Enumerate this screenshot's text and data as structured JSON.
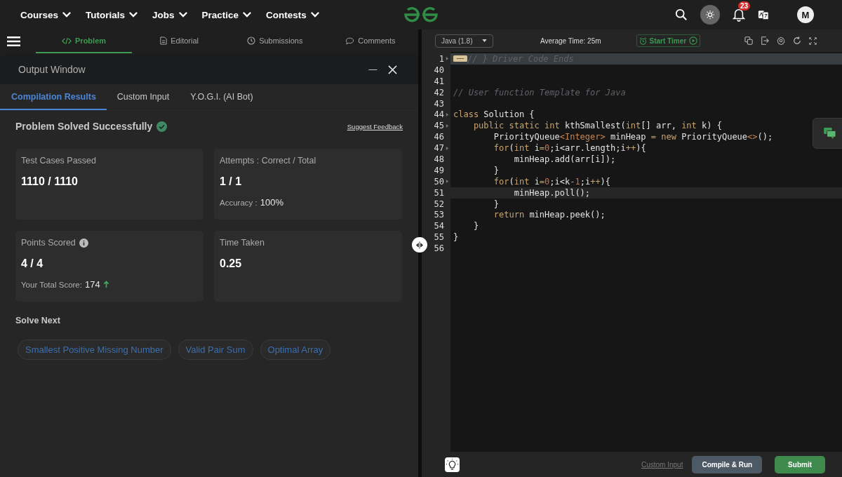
{
  "nav": {
    "items": [
      {
        "label": "Courses"
      },
      {
        "label": "Tutorials"
      },
      {
        "label": "Jobs"
      },
      {
        "label": "Practice"
      },
      {
        "label": "Contests"
      }
    ],
    "notification_count": "23",
    "avatar": "M"
  },
  "problem_tabs": [
    {
      "label": "Problem",
      "selected": true
    },
    {
      "label": "Editorial",
      "selected": false
    },
    {
      "label": "Submissions",
      "selected": false
    },
    {
      "label": "Comments",
      "selected": false
    }
  ],
  "output_window": {
    "title": "Output Window",
    "tabs": [
      {
        "label": "Compilation Results",
        "selected": true
      },
      {
        "label": "Custom Input",
        "selected": false
      },
      {
        "label": "Y.O.G.I. (AI Bot)",
        "selected": false
      }
    ],
    "status": "Problem Solved Successfully",
    "feedback_link": "Suggest Feedback",
    "cards": [
      {
        "label": "Test Cases Passed",
        "value": "1110 / 1110"
      },
      {
        "label": "Attempts : Correct / Total",
        "value": "1 / 1",
        "note": {
          "label": "Accuracy :",
          "value": "100%"
        }
      },
      {
        "label": "Points Scored",
        "info": true,
        "value": "4 / 4",
        "note": {
          "label": "Your Total Score:",
          "value": "174",
          "rising": true
        }
      },
      {
        "label": "Time Taken",
        "value": "0.25"
      }
    ],
    "solve_next": {
      "title": "Solve Next",
      "items": [
        "Smallest Positive Missing Number",
        "Valid Pair Sum",
        "Optimal Array"
      ]
    }
  },
  "editor": {
    "language": "Java (1.8)",
    "average_time": "Average Time: 25m",
    "timer_button": "Start Timer",
    "lines": [
      {
        "number": "1",
        "fold": true,
        "highlighted": true,
        "folded": true,
        "tokens": [
          {
            "kind": "comment",
            "text": "// } Driver Code Ends"
          }
        ]
      },
      {
        "number": "40",
        "fold": false,
        "highlighted": false
      },
      {
        "number": "41",
        "fold": false,
        "highlighted": false
      },
      {
        "number": "42",
        "fold": false,
        "highlighted": false,
        "tokens": [
          {
            "kind": "comment",
            "text": "// User function Template for Java"
          }
        ]
      },
      {
        "number": "43",
        "fold": false,
        "highlighted": false
      },
      {
        "number": "44",
        "fold": true,
        "highlighted": false,
        "tokens": [
          {
            "kind": "keyword",
            "text": "class"
          },
          {
            "kind": "plain",
            "text": " Solution {"
          }
        ]
      },
      {
        "number": "45",
        "fold": true,
        "highlighted": false,
        "tokens": [
          {
            "kind": "keyword",
            "text": "    public static int"
          },
          {
            "kind": "plain",
            "text": " kthSmallest("
          },
          {
            "kind": "keyword",
            "text": "int"
          },
          {
            "kind": "plain",
            "text": "[] arr, "
          },
          {
            "kind": "keyword",
            "text": "int"
          },
          {
            "kind": "plain",
            "text": " k) {"
          }
        ]
      },
      {
        "number": "46",
        "fold": false,
        "highlighted": false,
        "tokens": [
          {
            "kind": "plain",
            "text": "        PriorityQueue"
          },
          {
            "kind": "type",
            "text": "<Integer>"
          },
          {
            "kind": "plain",
            "text": " minHeap "
          },
          {
            "kind": "operator",
            "text": "="
          },
          {
            "kind": "keyword",
            "text": " new"
          },
          {
            "kind": "plain",
            "text": " PriorityQueue"
          },
          {
            "kind": "type",
            "text": "<>"
          },
          {
            "kind": "plain",
            "text": "();"
          }
        ]
      },
      {
        "number": "47",
        "fold": true,
        "highlighted": false,
        "tokens": [
          {
            "kind": "keyword",
            "text": "        for"
          },
          {
            "kind": "plain",
            "text": "("
          },
          {
            "kind": "keyword",
            "text": "int"
          },
          {
            "kind": "plain",
            "text": " i"
          },
          {
            "kind": "operator",
            "text": "="
          },
          {
            "kind": "number",
            "text": "0"
          },
          {
            "kind": "plain",
            "text": ";i<arr.length;i"
          },
          {
            "kind": "operator",
            "text": "++"
          },
          {
            "kind": "plain",
            "text": "){"
          }
        ]
      },
      {
        "number": "48",
        "fold": false,
        "highlighted": false,
        "tokens": [
          {
            "kind": "plain",
            "text": "            minHeap.add(arr[i]);"
          }
        ]
      },
      {
        "number": "49",
        "fold": false,
        "highlighted": false,
        "tokens": [
          {
            "kind": "plain",
            "text": "        }"
          }
        ]
      },
      {
        "number": "50",
        "fold": true,
        "highlighted": false,
        "tokens": [
          {
            "kind": "keyword",
            "text": "        for"
          },
          {
            "kind": "plain",
            "text": "("
          },
          {
            "kind": "keyword",
            "text": "int"
          },
          {
            "kind": "plain",
            "text": " i"
          },
          {
            "kind": "operator",
            "text": "="
          },
          {
            "kind": "number",
            "text": "0"
          },
          {
            "kind": "plain",
            "text": ";i<k"
          },
          {
            "kind": "operator",
            "text": "-"
          },
          {
            "kind": "number",
            "text": "1"
          },
          {
            "kind": "plain",
            "text": ";i"
          },
          {
            "kind": "operator",
            "text": "++"
          },
          {
            "kind": "plain",
            "text": "){"
          }
        ]
      },
      {
        "number": "51",
        "fold": false,
        "highlighted": true,
        "tokens": [
          {
            "kind": "plain",
            "text": "            minHeap.poll();"
          }
        ]
      },
      {
        "number": "52",
        "fold": false,
        "highlighted": false,
        "tokens": [
          {
            "kind": "plain",
            "text": "        }"
          }
        ]
      },
      {
        "number": "53",
        "fold": false,
        "highlighted": false,
        "tokens": [
          {
            "kind": "keyword",
            "text": "        return"
          },
          {
            "kind": "plain",
            "text": " minHeap.peek();"
          }
        ]
      },
      {
        "number": "54",
        "fold": false,
        "highlighted": false,
        "tokens": [
          {
            "kind": "plain",
            "text": "    }"
          }
        ]
      },
      {
        "number": "55",
        "fold": false,
        "highlighted": false,
        "tokens": [
          {
            "kind": "plain",
            "text": "}"
          }
        ]
      },
      {
        "number": "56",
        "fold": false,
        "highlighted": false
      }
    ],
    "custom_input_link": "Custom Input",
    "compile_button": "Compile & Run",
    "submit_button": "Submit"
  }
}
